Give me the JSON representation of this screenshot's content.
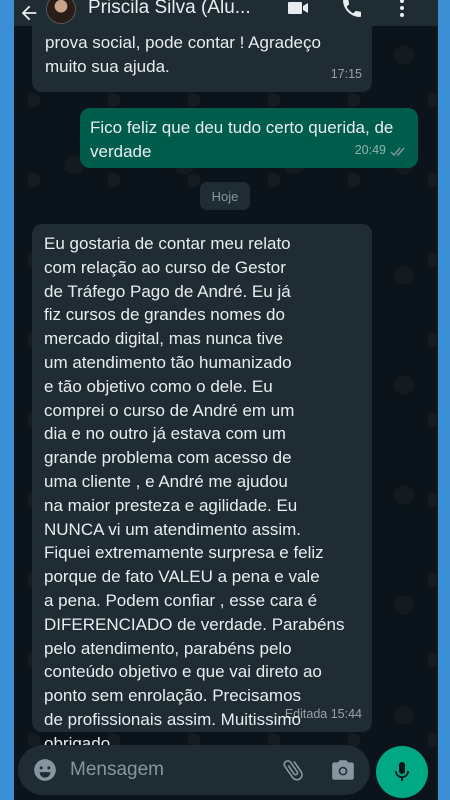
{
  "header": {
    "contact_name": "Priscila Silva (Alu..."
  },
  "chat": {
    "date_separator": "Hoje",
    "messages": [
      {
        "direction": "incoming",
        "text": "prova social, pode contar ! Agradeço muito sua ajuda.",
        "time": "17:15"
      },
      {
        "direction": "outgoing",
        "text": "Fico feliz que deu tudo certo querida, de verdade",
        "time": "20:49",
        "status": "read"
      },
      {
        "direction": "incoming",
        "text": "Eu gostaria de contar meu relato\ncom relação ao curso de Gestor\nde Tráfego Pago de André. Eu já\nfiz cursos de grandes nomes do\nmercado digital, mas nunca tive\num atendimento tão humanizado\ne tão objetivo como o dele. Eu\ncomprei o curso de André  em um\ndia e no outro já estava com um\ngrande problema com acesso de\numa cliente ,  e André me ajudou\nna maior presteza e agilidade. Eu\nNUNCA vi um atendimento assim.\nFiquei extremamente surpresa e feliz\nporque de fato VALEU a pena e vale\na pena. Podem confiar , esse cara é\nDIFERENCIADO de verdade. Parabéns\npelo atendimento, parabéns pelo\nconteúdo objetivo e que vai direto ao\nponto sem enrolação. Precisamos\nde profissionais assim. Muitissimo\nobrigado.",
        "time": "Editada 15:44"
      }
    ]
  },
  "input_bar": {
    "placeholder": "Mensagem"
  },
  "colors": {
    "background": "#0b141a",
    "incoming_bubble": "#1f2c34",
    "outgoing_bubble": "#005c4b",
    "accent": "#00a884",
    "read_ticks": "#8696a0"
  }
}
